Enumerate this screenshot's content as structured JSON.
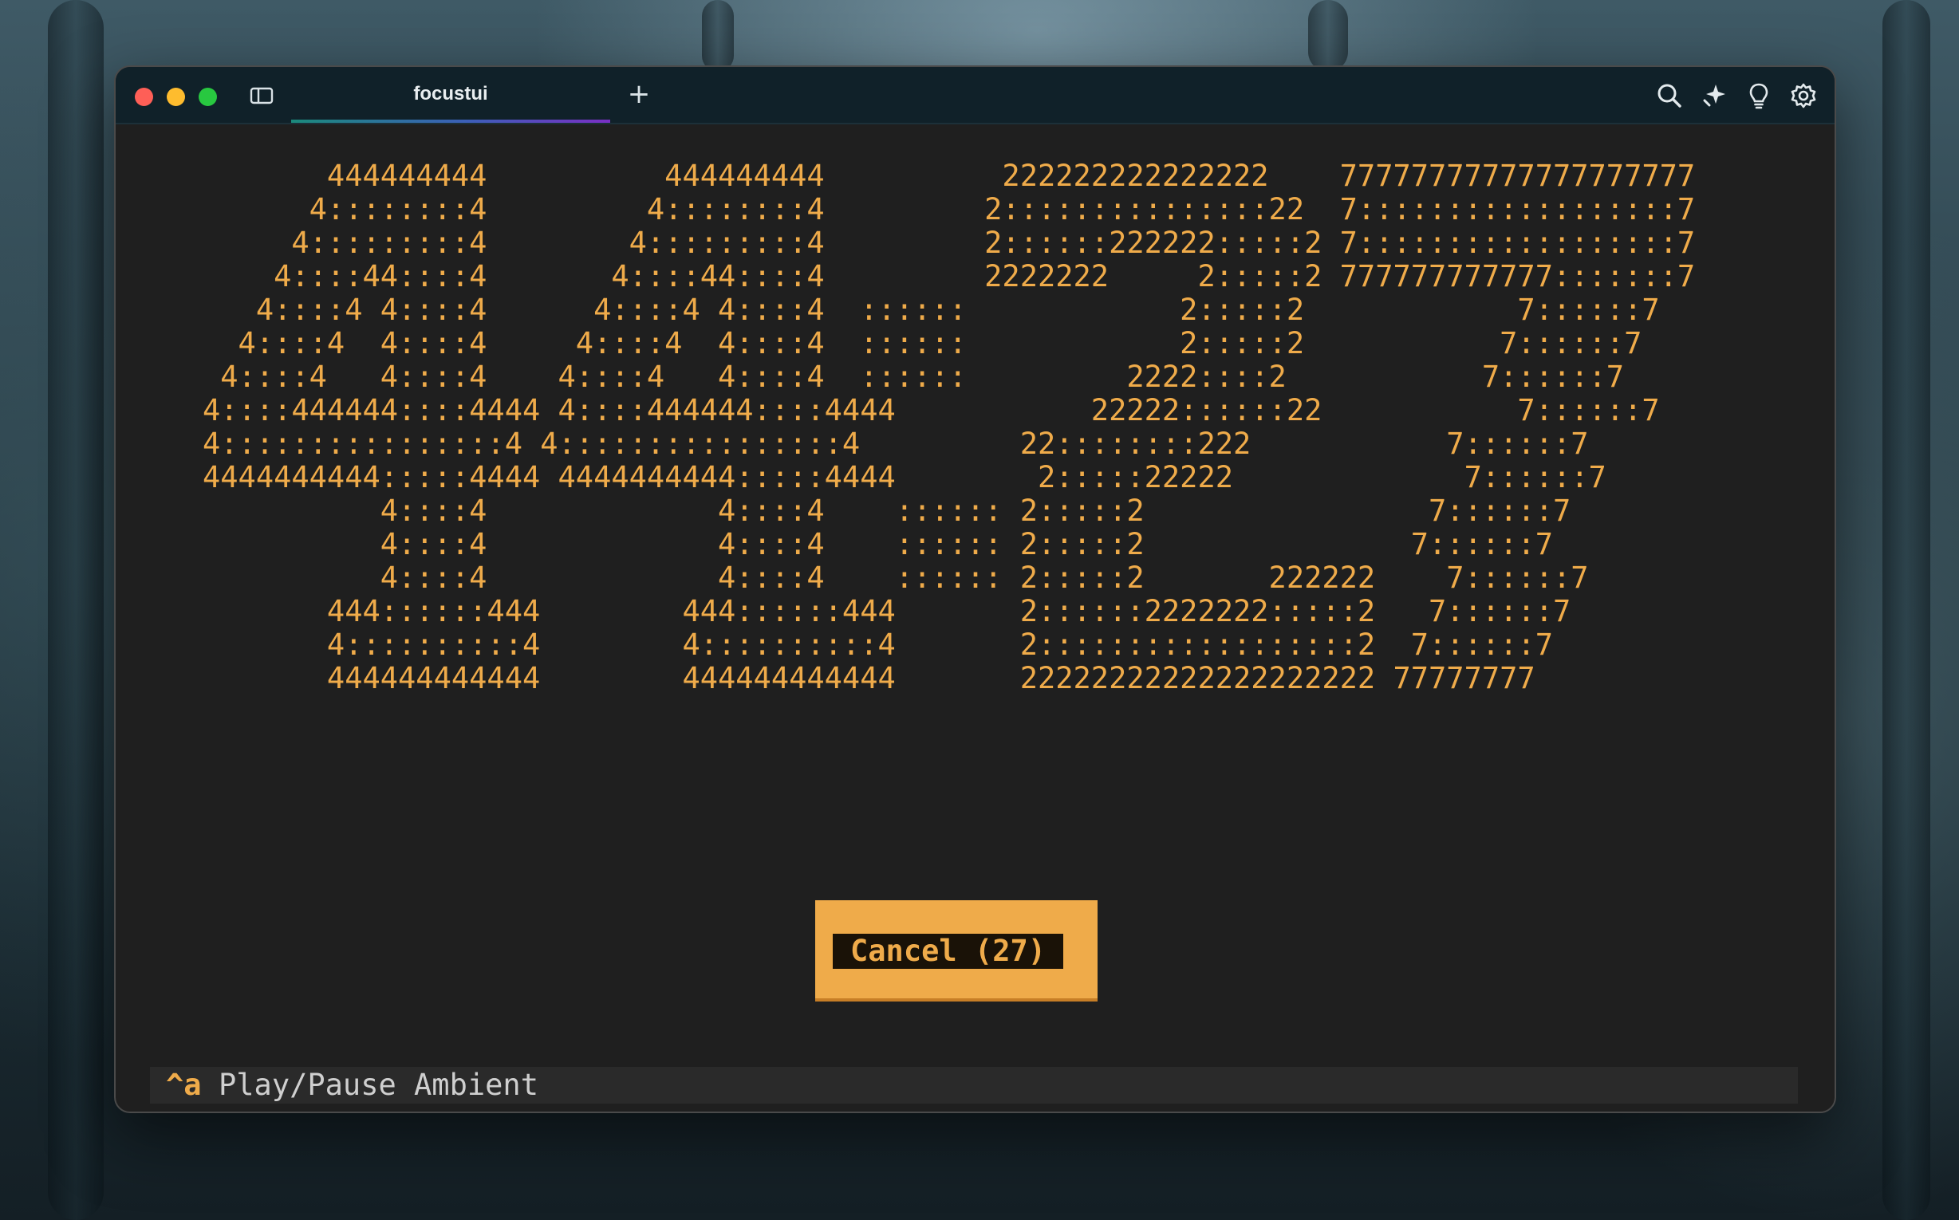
{
  "window": {
    "tab_title": "focustui",
    "new_tab_symbol": "+"
  },
  "toolbar_icons": [
    "search-icon",
    "sparkle-icon",
    "lightbulb-icon",
    "gear-icon"
  ],
  "ascii_art": {
    "lines": [
      "       444444444          444444444          222222222222222    77777777777777777777",
      "      4::::::::4         4::::::::4         2:::::::::::::::22  7::::::::::::::::::7",
      "     4:::::::::4        4:::::::::4         2::::::222222:::::2 7::::::::::::::::::7",
      "    4::::44::::4       4::::44::::4         2222222     2:::::2 777777777777:::::::7",
      "   4::::4 4::::4      4::::4 4::::4  ::::::            2:::::2            7::::::7 ",
      "  4::::4  4::::4     4::::4  4::::4  ::::::            2:::::2           7::::::7  ",
      " 4::::4   4::::4    4::::4   4::::4  ::::::         2222::::2           7::::::7   ",
      "4::::444444::::4444 4::::444444::::4444           22222::::::22           7::::::7    ",
      "4::::::::::::::::4 4::::::::::::::::4         22::::::::222           7::::::7     ",
      "4444444444:::::4444 4444444444:::::4444        2:::::22222             7::::::7      ",
      "          4::::4             4::::4    :::::: 2:::::2                7::::::7       ",
      "          4::::4             4::::4    :::::: 2:::::2               7::::::7        ",
      "          4::::4             4::::4    :::::: 2:::::2       222222    7::::::7         ",
      "       444::::::444        444::::::444       2::::::2222222:::::2   7::::::7          ",
      "       4::::::::::4        4::::::::::4       2::::::::::::::::::2  7::::::7           ",
      "       444444444444        444444444444       22222222222222222222 77777777            "
    ]
  },
  "cancel_button": {
    "label": "Cancel (27)"
  },
  "status_bar": {
    "key": "^a",
    "label": "Play/Pause Ambient"
  }
}
